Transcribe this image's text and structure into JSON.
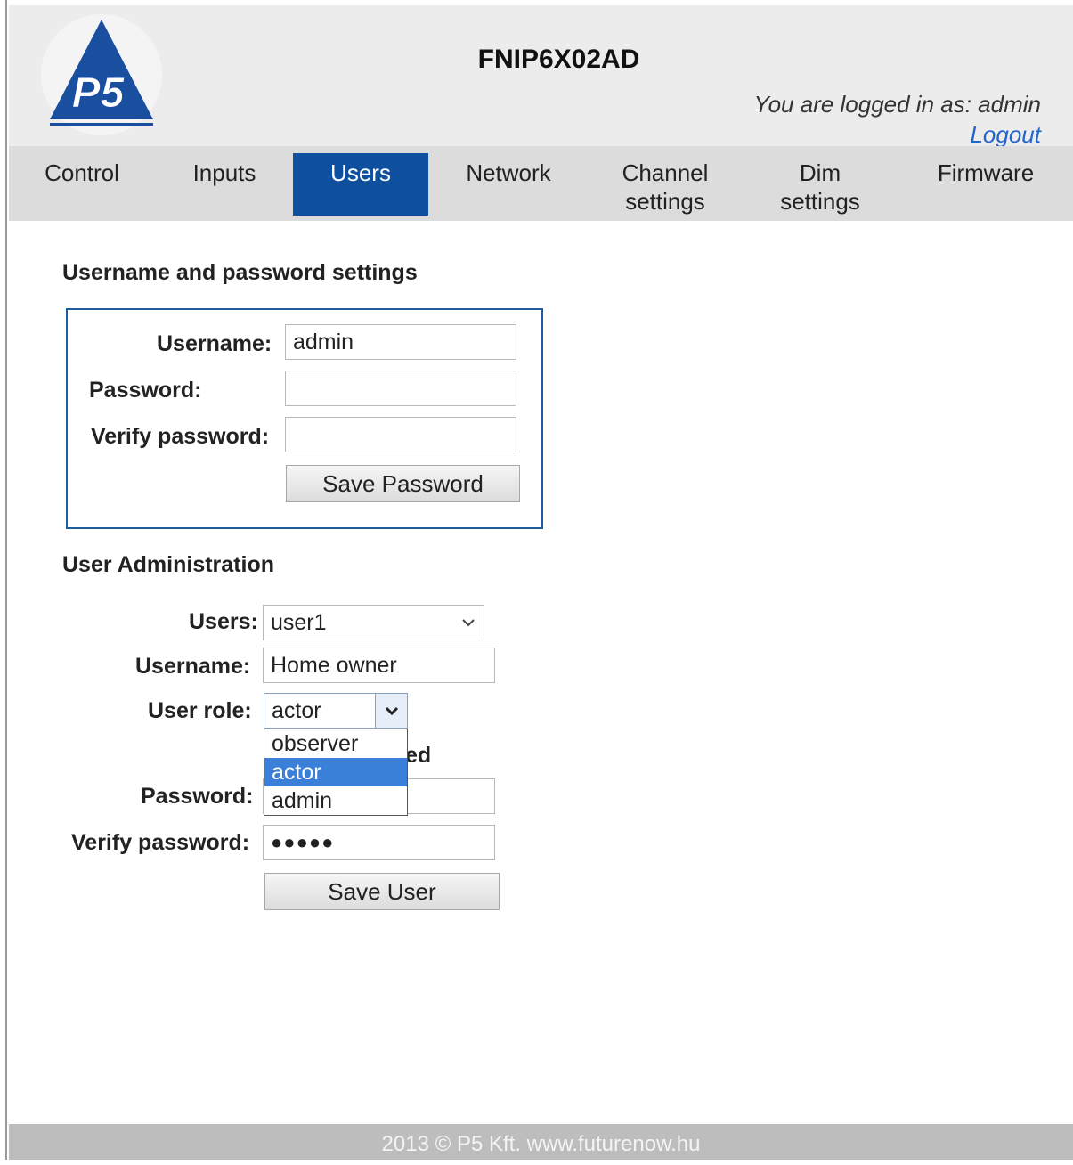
{
  "header": {
    "logo_text": "P5",
    "device_title": "FNIP6X02AD",
    "logged_in_text": "You are logged in as: admin",
    "logout_label": "Logout"
  },
  "nav": {
    "items": [
      {
        "label": "Control"
      },
      {
        "label": "Inputs"
      },
      {
        "label": "Users"
      },
      {
        "label": "Network"
      },
      {
        "label": "Channel settings"
      },
      {
        "label": "Dim settings"
      },
      {
        "label": "Firmware"
      }
    ],
    "active": "Users",
    "active_color": "#0e4fa0"
  },
  "password_settings": {
    "title": "Username and password settings",
    "username_label": "Username:",
    "username_value": "admin",
    "password_label": "Password:",
    "password_value": "",
    "verify_label": "Verify password:",
    "verify_value": "",
    "save_label": "Save Password"
  },
  "user_admin": {
    "title": "User Administration",
    "users_label": "Users:",
    "users_selected": "user1",
    "username_label": "Username:",
    "username_value": "Home owner",
    "role_label": "User role:",
    "role_selected": "actor",
    "role_options": [
      "observer",
      "actor",
      "admin"
    ],
    "enabled_partial": "led",
    "password_label": "Password:",
    "verify_label": "Verify password:",
    "verify_value": "●●●●●",
    "save_label": "Save User"
  },
  "footer": {
    "text": "2013 © P5 Kft.  www.futurenow.hu"
  }
}
